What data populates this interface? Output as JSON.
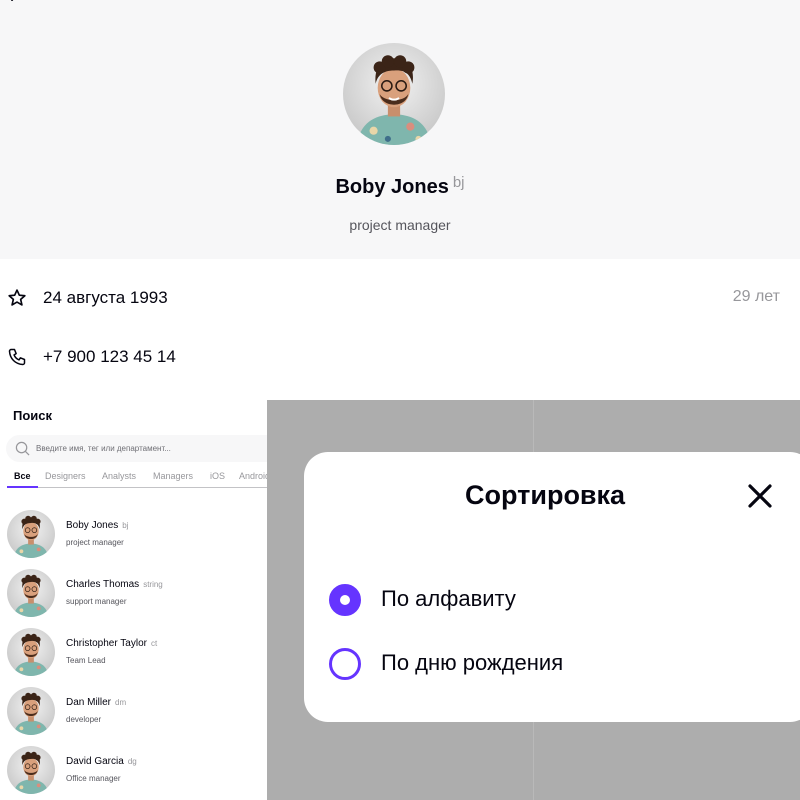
{
  "profile": {
    "name": "Boby Jones",
    "tag": "bj",
    "position": "project manager",
    "birthday": "24 августа 1993",
    "age": "29 лет",
    "phone": "+7 900 123 45 14"
  },
  "list": {
    "title": "Поиск",
    "search_placeholder": "Введите имя, тег или департамент...",
    "tabs": [
      {
        "label": "Все",
        "active": true
      },
      {
        "label": "Designers"
      },
      {
        "label": "Analysts"
      },
      {
        "label": "Managers"
      },
      {
        "label": "iOS"
      },
      {
        "label": "Android"
      }
    ],
    "people": [
      {
        "name": "Boby Jones",
        "tag": "bj",
        "position": "project manager"
      },
      {
        "name": "Charles Thomas",
        "tag": "string",
        "position": "support manager"
      },
      {
        "name": "Christopher Taylor",
        "tag": "ct",
        "position": "Team Lead"
      },
      {
        "name": "Dan Miller",
        "tag": "dm",
        "position": "developer"
      },
      {
        "name": "David Garcia",
        "tag": "dg",
        "position": "Office manager"
      }
    ]
  },
  "sort_modal": {
    "title": "Сортировка",
    "options": [
      {
        "label": "По алфавиту",
        "selected": true
      },
      {
        "label": "По дню рождения",
        "selected": false
      }
    ]
  },
  "colors": {
    "accent": "#6534ff",
    "header_bg": "#f7f7f8",
    "overlay": "#adadad",
    "text_primary": "#050510",
    "text_secondary": "#97979b"
  }
}
